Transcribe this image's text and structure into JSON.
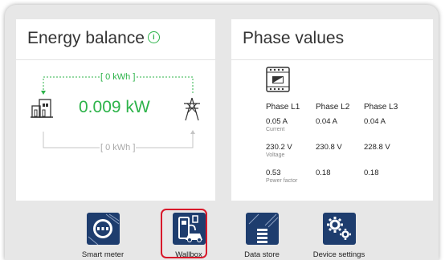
{
  "energy": {
    "title": "Energy balance",
    "info": "i",
    "top_flow": "[ 0 kWh ]",
    "bottom_flow": "[ 0 kWh ]",
    "power": "0.009 kW"
  },
  "phase": {
    "title": "Phase values",
    "headers": [
      "Phase L1",
      "Phase L2",
      "Phase L3"
    ],
    "rows": [
      {
        "l1": "0.05 A",
        "l2": "0.04 A",
        "l3": "0.04 A",
        "label": "Current"
      },
      {
        "l1": "230.2 V",
        "l2": "230.8 V",
        "l3": "228.8 V",
        "label": "Voltage"
      },
      {
        "l1": "0.53",
        "l2": "0.18",
        "l3": "0.18",
        "label": "Power factor"
      }
    ]
  },
  "nav": {
    "items": [
      {
        "label": "Smart meter",
        "icon": "smart-meter-icon"
      },
      {
        "label": "Wallbox",
        "icon": "wallbox-icon"
      },
      {
        "label": "Data store",
        "icon": "data-store-icon"
      },
      {
        "label": "Device settings",
        "icon": "device-settings-icon"
      }
    ]
  },
  "colors": {
    "accent_green": "#2db34a",
    "nav_icon_bg": "#1e3d6e",
    "highlight_red": "#d8182a"
  }
}
